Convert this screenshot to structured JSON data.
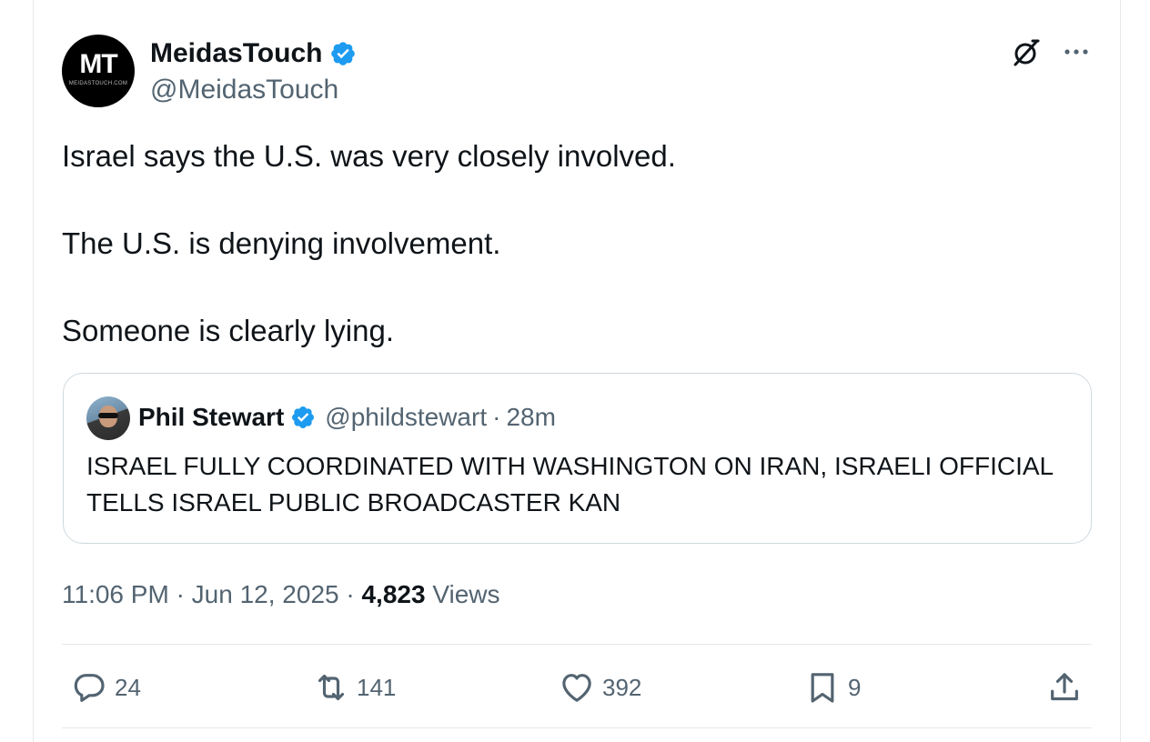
{
  "author": {
    "name": "MeidasTouch",
    "handle": "@MeidasTouch",
    "avatar_text": "MT",
    "avatar_subtext": "MEIDASTOUCH.COM"
  },
  "tweet": {
    "lines": [
      "Israel says the U.S. was very closely involved.",
      "The U.S. is denying involvement.",
      "Someone is clearly lying."
    ]
  },
  "quoted": {
    "name": "Phil Stewart",
    "handle": "@phildstewart",
    "separator": "·",
    "time": "28m",
    "text": "ISRAEL FULLY COORDINATED WITH WASHINGTON ON IRAN, ISRAELI OFFICIAL TELLS ISRAEL PUBLIC BROADCASTER KAN"
  },
  "meta": {
    "time": "11:06 PM",
    "separator": "·",
    "date": "Jun 12, 2025",
    "views_count": "4,823",
    "views_label": "Views"
  },
  "actions": {
    "replies": "24",
    "reposts": "141",
    "likes": "392",
    "bookmarks": "9"
  },
  "icons": {
    "verified": "verified-badge-icon",
    "grok": "grok-icon",
    "more": "more-icon",
    "reply": "reply-icon",
    "repost": "repost-icon",
    "like": "heart-icon",
    "bookmark": "bookmark-icon",
    "share": "share-icon"
  },
  "colors": {
    "verified_blue": "#1d9bf0",
    "secondary_text": "#536471",
    "primary_text": "#0f1419",
    "border": "#cfd9de"
  }
}
